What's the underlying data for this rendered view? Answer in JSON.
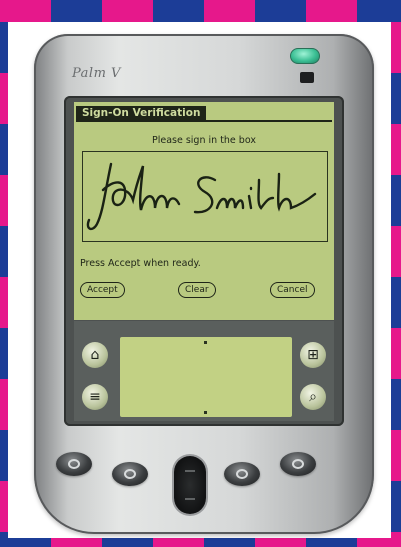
{
  "device": {
    "brand": "Palm V"
  },
  "dialog": {
    "title": "Sign-On Verification",
    "instruction": "Please sign in the box",
    "signature_text": "John Smith",
    "status_message": "Press Accept when ready.",
    "buttons": {
      "accept": "Accept",
      "clear": "Clear",
      "cancel": "Cancel"
    }
  },
  "silkscreen": {
    "icons": [
      "home-icon",
      "menu-icon",
      "calculator-icon",
      "find-icon"
    ]
  },
  "colors": {
    "frame_magenta": "#e6188b",
    "frame_blue": "#1c3d97",
    "lcd_green": "#b9ca80",
    "lcd_ink": "#1f2518"
  }
}
